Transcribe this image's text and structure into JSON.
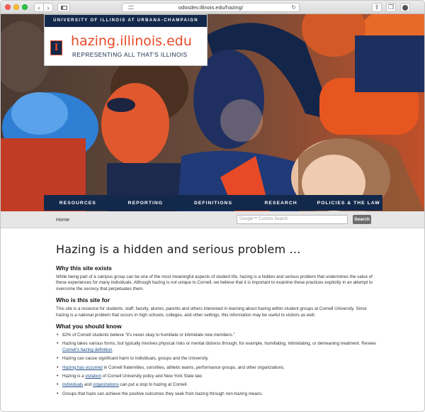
{
  "browser": {
    "url": "odosdev.illinois.edu/hazing/"
  },
  "site": {
    "header_strip": "UNIVERSITY OF ILLINOIS AT URBANA-CHAMPAIGN",
    "logo_letter": "I",
    "domain": "hazing.illinois.edu",
    "tagline": "REPRESENTING ALL THAT'S ILLINOIS"
  },
  "nav": {
    "items": [
      {
        "label": "RESOURCES"
      },
      {
        "label": "REPORTING"
      },
      {
        "label": "DEFINITIONS"
      },
      {
        "label": "RESEARCH"
      },
      {
        "label": "POLICIES & THE LAW"
      }
    ]
  },
  "breadcrumb": {
    "home": "Home"
  },
  "search": {
    "placeholder": "Google™ Custom Search",
    "button": "Search"
  },
  "main": {
    "title": "Hazing is a hidden and serious problem ...",
    "sections": [
      {
        "heading": "Why this site exists",
        "text": "While being part of a campus group can be one of the most meaningful aspects of student life, hazing is a hidden and serious problem that undermines the value of these experiences for many individuals. Although hazing is not unique to Cornell, we believe that it is important to examine these practices explicitly in an attempt to overcome the secrecy that perpetuates them."
      },
      {
        "heading": "Who is this site for",
        "text": "This site is a resource for students, staff, faculty, alumni, parents and others interested in learning about hazing within student groups at Cornell University. Since hazing is a national problem that occurs in high schools, colleges, and other settings, this information may be useful to visitors as well."
      },
      {
        "heading": "What you should know"
      }
    ],
    "bullets": {
      "b1": "82% of Cornell students believe \"it's never okay to humiliate or intimidate new members.\"",
      "b2_pre": "Hazing takes various forms, but typically involves physical risks or mental distress through, for example, humiliating, intimidating, or demeaning treatment. Review ",
      "b2_link": "Cornell's hazing definition",
      "b2_post": ".",
      "b3": "Hazing can cause significant harm to individuals, groups and the University.",
      "b4_link": "Hazing has occurred",
      "b4_post": " in Cornell fraternities, sororities, athletic teams, performance groups, and other organizations.",
      "b5_pre": "Hazing is a ",
      "b5_link": "violation",
      "b5_post": " of Cornell University policy and New York State law.",
      "b6_link1": "Individuals",
      "b6_mid": " and ",
      "b6_link2": "organizations",
      "b6_post": " can put a stop to hazing at Cornell.",
      "b7": "Groups that haze can achieve the positive outcomes they seek from hazing through non-hazing means."
    }
  },
  "colors": {
    "illini_blue": "#13294b",
    "illini_orange": "#e84a27",
    "link": "#1e4e8a"
  }
}
